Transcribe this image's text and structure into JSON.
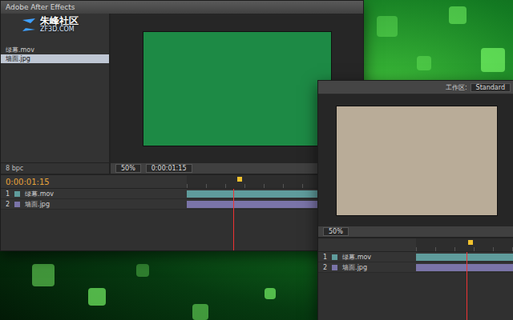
{
  "watermark": {
    "name": "朱峰社区",
    "url": "ZF3D.COM"
  },
  "main_window": {
    "title": "Adobe After Effects",
    "project": {
      "items": [
        {
          "name": "绿幕.mov",
          "selected": false
        },
        {
          "name": "墙面.jpg",
          "selected": true
        }
      ],
      "footer": "8 bpc"
    },
    "viewer": {
      "zoom": "50%",
      "timecode": "0:00:01:15"
    },
    "timeline": {
      "timecode": "0:00:01:15",
      "playhead": 0.3,
      "layers": [
        {
          "index": "1",
          "name": "绿幕.mov",
          "color": "#5f9c9c"
        },
        {
          "index": "2",
          "name": "墙面.jpg",
          "color": "#7a74a8"
        }
      ]
    }
  },
  "second_window": {
    "workspace_label": "工作区:",
    "workspace": "Standard",
    "viewer": {
      "zoom": "50%"
    },
    "timeline": {
      "playhead": 0.55,
      "layers": [
        {
          "index": "1",
          "name": "绿幕.mov",
          "color": "#5f9c9c"
        },
        {
          "index": "2",
          "name": "墙面.jpg",
          "color": "#7a74a8"
        }
      ]
    }
  }
}
